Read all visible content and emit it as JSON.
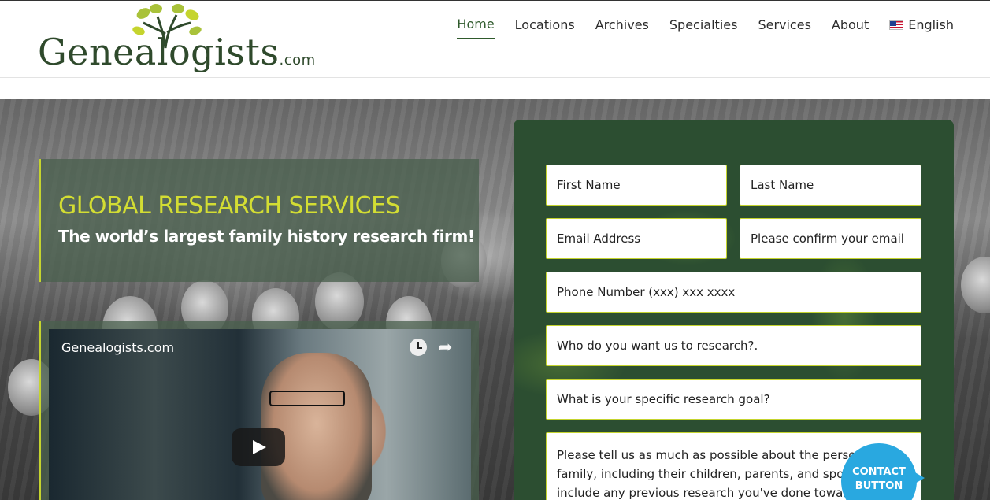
{
  "brand": {
    "name": "Genealogists",
    "suffix": ".com",
    "colors": {
      "primary": "#2f4a2c",
      "accent": "#c5d42e",
      "form_bg": "#2c4e31",
      "contact": "#29a8e0"
    }
  },
  "nav": {
    "items": [
      {
        "label": "Home",
        "active": true
      },
      {
        "label": "Locations"
      },
      {
        "label": "Archives"
      },
      {
        "label": "Specialties"
      },
      {
        "label": "Services"
      },
      {
        "label": "About"
      }
    ],
    "language": {
      "label": "English",
      "icon": "us-flag-icon"
    }
  },
  "hero": {
    "title": "GLOBAL RESEARCH SERVICES",
    "subtitle": "The world’s largest family history research firm!"
  },
  "video": {
    "title": "Genealogists.com",
    "icons": [
      "watch-later-icon",
      "share-icon",
      "play-icon"
    ]
  },
  "form": {
    "first_name": "First Name",
    "last_name": "Last Name",
    "email": "Email Address",
    "email_confirm": "Please confirm your email",
    "phone": "Phone Number (xxx) xxx xxxx",
    "who": "Who do you want us to research?.",
    "goal": "What is your specific research goal?",
    "details": "Please tell us as much as possible about the person or family, including their children, parents, and spouse. Also include any previous research you've done toward"
  },
  "contact_button": {
    "line1": "CONTACT",
    "line2": "BUTTON"
  }
}
